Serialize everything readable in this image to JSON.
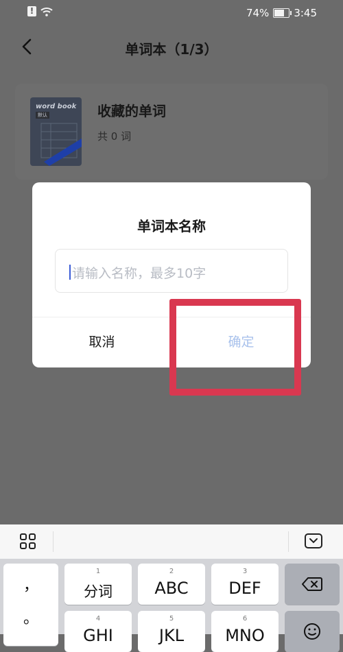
{
  "status_bar": {
    "battery": "74%",
    "battery_level": 0.74,
    "time": "3:45",
    "alert_glyph": "!"
  },
  "nav": {
    "title": "单词本（1/3）"
  },
  "book": {
    "cover_text": "word book",
    "cover_tag": "默认",
    "name": "收藏的单词",
    "count": "共 0 词"
  },
  "dialog": {
    "title": "单词本名称",
    "input_placeholder": "请输入名称，最多10字",
    "input_value": "",
    "cancel_label": "取消",
    "confirm_label": "确定"
  },
  "keyboard": {
    "keys": [
      {
        "num": "1",
        "label": "分词"
      },
      {
        "num": "2",
        "label": "ABC"
      },
      {
        "num": "3",
        "label": "DEF"
      },
      {
        "num": "4",
        "label": "GHI"
      },
      {
        "num": "5",
        "label": "JKL"
      },
      {
        "num": "6",
        "label": "MNO"
      }
    ],
    "left_symbols": [
      "，",
      "。"
    ]
  },
  "colors": {
    "highlight": "#d93850",
    "confirm_text": "#a9c2ec",
    "overlay": "#6b6b6b"
  },
  "icons": [
    "wifi-icon",
    "battery-icon",
    "back-arrow-icon",
    "grid-menu-icon",
    "keyboard-collapse-icon",
    "backspace-icon",
    "emoji-icon"
  ]
}
